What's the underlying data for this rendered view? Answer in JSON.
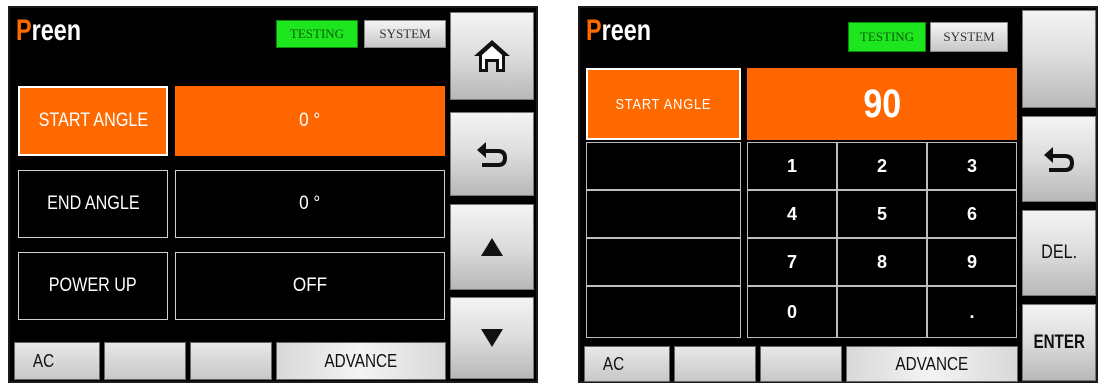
{
  "brand": {
    "first": "P",
    "rest": "reen"
  },
  "tabs": {
    "testing": "TESTING",
    "system": "SYSTEM"
  },
  "left": {
    "rows": [
      {
        "label": "START ANGLE",
        "value": "0 °"
      },
      {
        "label": "END ANGLE",
        "value": "0 °"
      },
      {
        "label": "POWER UP",
        "value": "OFF"
      }
    ],
    "side_buttons": [
      "home-icon",
      "back-icon",
      "up-arrow-icon",
      "down-arrow-icon"
    ],
    "bottom": {
      "ac": "AC",
      "advance": "ADVANCE"
    }
  },
  "right": {
    "field_label": "START ANGLE",
    "field_value": "90",
    "keys": [
      "1",
      "2",
      "3",
      "4",
      "5",
      "6",
      "7",
      "8",
      "9",
      "0",
      "."
    ],
    "side": {
      "del": "DEL.",
      "enter": "ENTER"
    },
    "bottom": {
      "ac": "AC",
      "advance": "ADVANCE"
    }
  },
  "colors": {
    "accent": "#ff6600",
    "testing": "#1ee61e",
    "background": "#000000"
  }
}
